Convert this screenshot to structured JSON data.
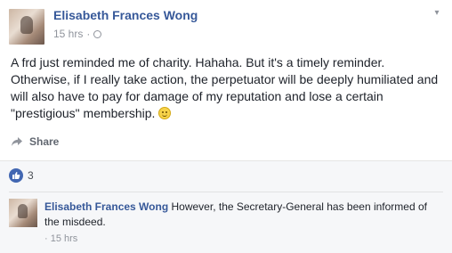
{
  "post": {
    "author": "Elisabeth Frances Wong",
    "time": "15 hrs",
    "separator": "·",
    "text": "A frd just reminded me of charity. Hahaha. But it's a timely reminder. Otherwise, if I really take action, the perpetuator will be deeply humiliated and will also have to pay for damage of my reputation and lose a certain \"prestigious\" membership.",
    "share_label": "Share"
  },
  "reactions": {
    "like_count": "3",
    "like_color": "#4267b2"
  },
  "comment": {
    "author": "Elisabeth Frances Wong",
    "text": "However, the Secretary-General has been informed of the misdeed.",
    "time": "15 hrs",
    "separator": "·"
  },
  "colors": {
    "author_link": "#365899",
    "meta": "#90949c"
  },
  "icons": [
    "globe-icon",
    "chevron-down-icon",
    "smiley-icon",
    "share-icon",
    "like-icon"
  ]
}
